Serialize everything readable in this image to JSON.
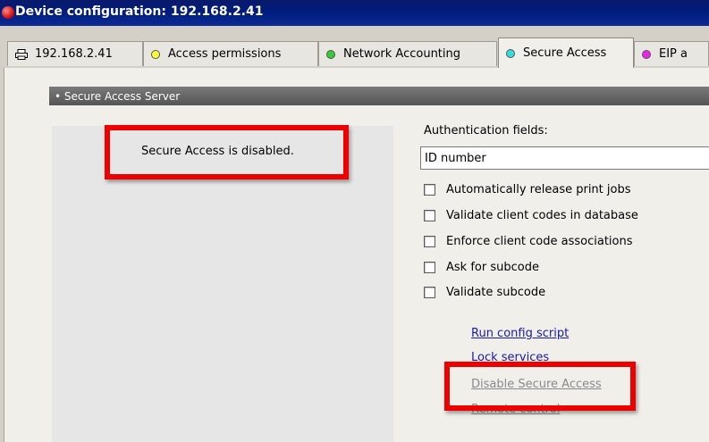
{
  "window": {
    "title": "Device configuration: 192.168.2.41"
  },
  "tabs": [
    {
      "label": "192.168.2.41",
      "icon": "printer-icon"
    },
    {
      "label": "Access permissions",
      "dot_color": "#ffff33"
    },
    {
      "label": "Network Accounting",
      "dot_color": "#33cc33"
    },
    {
      "label": "Secure Access",
      "dot_color": "#33dddd",
      "active": true
    },
    {
      "label": "EIP a",
      "dot_color": "#ee22ee"
    }
  ],
  "section": {
    "header": "• Secure Access Server"
  },
  "status": {
    "message": "Secure Access is disabled."
  },
  "auth": {
    "label": "Authentication fields:",
    "value": "ID number"
  },
  "options": [
    {
      "label": "Automatically release print jobs",
      "checked": false
    },
    {
      "label": "Validate client codes in database",
      "checked": false
    },
    {
      "label": "Enforce client code associations",
      "checked": false
    },
    {
      "label": "Ask for subcode",
      "checked": false
    },
    {
      "label": "Validate subcode",
      "checked": false
    }
  ],
  "links": {
    "run_config_script": "Run config script",
    "lock_services": "Lock services",
    "disable_secure_access": "Disable Secure Access",
    "remote_control": "Remote control"
  },
  "colors": {
    "highlight_box": "#ee0000",
    "link": "#1a1aa6",
    "titlebar": "#001b7a"
  }
}
